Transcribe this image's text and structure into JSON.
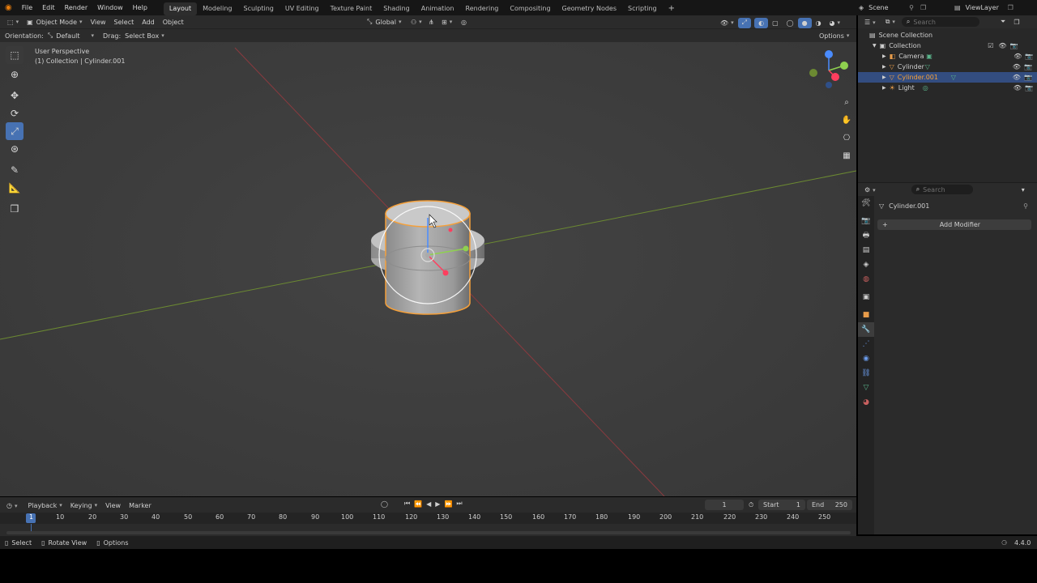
{
  "topbar": {
    "menus": [
      "File",
      "Edit",
      "Render",
      "Window",
      "Help"
    ],
    "workspaces": [
      "Layout",
      "Modeling",
      "Sculpting",
      "UV Editing",
      "Texture Paint",
      "Shading",
      "Animation",
      "Rendering",
      "Compositing",
      "Geometry Nodes",
      "Scripting"
    ],
    "active_workspace": "Layout",
    "scene": "Scene",
    "view_layer": "ViewLayer"
  },
  "viewport_header": {
    "mode": "Object Mode",
    "menus": [
      "View",
      "Select",
      "Add",
      "Object"
    ],
    "transform": "Global",
    "orientation_label": "Orientation:",
    "orientation_value": "Default",
    "drag_label": "Drag:",
    "drag_value": "Select Box",
    "options": "Options"
  },
  "viewport": {
    "perspective": "User Perspective",
    "context": "(1) Collection | Cylinder.001"
  },
  "outliner": {
    "search_placeholder": "Search",
    "root": "Scene Collection",
    "collection": "Collection",
    "items": [
      {
        "name": "Camera",
        "selected": false
      },
      {
        "name": "Cylinder",
        "selected": false
      },
      {
        "name": "Cylinder.001",
        "selected": true
      },
      {
        "name": "Light",
        "selected": false
      }
    ]
  },
  "properties": {
    "search_placeholder": "Search",
    "object_name": "Cylinder.001",
    "add_modifier": "Add Modifier"
  },
  "timeline": {
    "menus": [
      "Playback",
      "Keying",
      "View",
      "Marker"
    ],
    "current_frame": "1",
    "start_label": "Start",
    "start": "1",
    "end_label": "End",
    "end": "250",
    "ruler": [
      "1",
      "10",
      "20",
      "30",
      "40",
      "50",
      "60",
      "70",
      "80",
      "90",
      "100",
      "110",
      "120",
      "130",
      "140",
      "150",
      "160",
      "170",
      "180",
      "190",
      "200",
      "210",
      "220",
      "230",
      "240",
      "250"
    ]
  },
  "statusbar": {
    "select": "Select",
    "rotate": "Rotate View",
    "options": "Options",
    "version": "4.4.0"
  },
  "colors": {
    "accent": "#4772b3",
    "selected_outline": "#f5a03a",
    "axis_x": "#b8484f",
    "axis_y": "#7fa33a"
  }
}
